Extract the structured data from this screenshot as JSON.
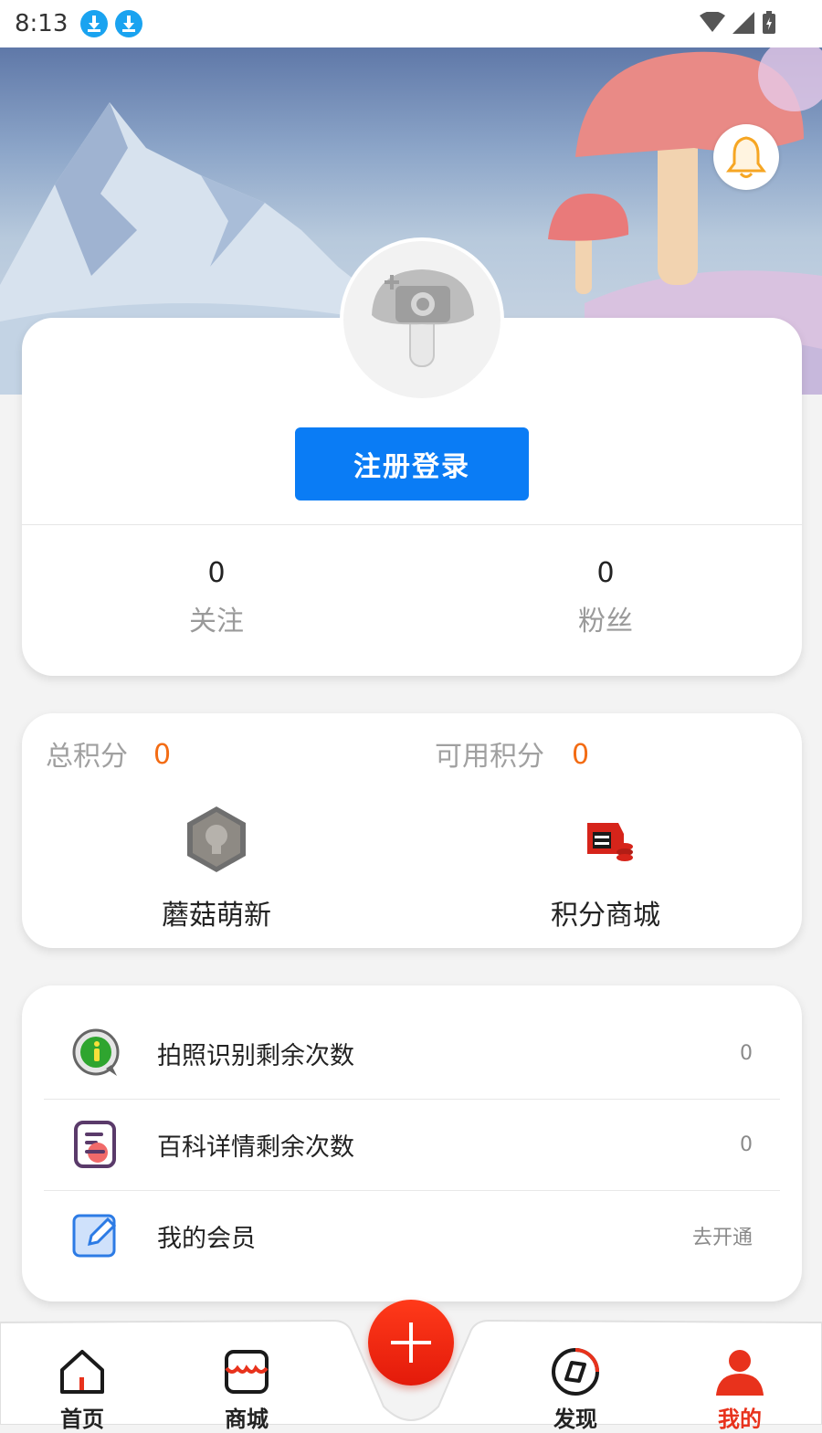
{
  "status_bar": {
    "time": "8:13",
    "icons": [
      "download-icon",
      "download-icon",
      "wifi-icon",
      "signal-icon",
      "battery-icon"
    ]
  },
  "header": {
    "bell_icon": "bell-icon"
  },
  "profile": {
    "login_label": "注册登录",
    "following_count": "0",
    "following_label": "关注",
    "fans_count": "0",
    "fans_label": "粉丝"
  },
  "points": {
    "total_label": "总积分",
    "total_value": "0",
    "available_label": "可用积分",
    "available_value": "0",
    "level_label": "蘑菇萌新",
    "mall_label": "积分商城"
  },
  "menu": {
    "items": [
      {
        "label": "拍照识别剩余次数",
        "value": "0",
        "icon": "info-chat-icon"
      },
      {
        "label": "百科详情剩余次数",
        "value": "0",
        "icon": "document-icon"
      },
      {
        "label": "我的会员",
        "value": "去开通",
        "icon": "edit-icon"
      }
    ]
  },
  "tabbar": {
    "tabs": [
      {
        "label": "首页",
        "icon": "home-icon"
      },
      {
        "label": "商城",
        "icon": "shop-icon"
      },
      {
        "label": "发现",
        "icon": "discover-icon"
      },
      {
        "label": "我的",
        "icon": "user-icon"
      }
    ],
    "active": "我的"
  },
  "colors": {
    "primary_blue": "#0a7cf5",
    "accent_orange": "#f36c14",
    "active_red": "#e8321c"
  }
}
